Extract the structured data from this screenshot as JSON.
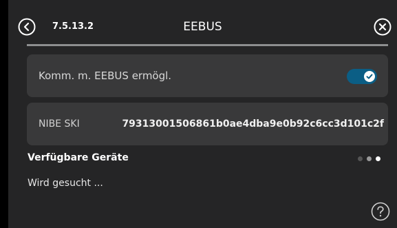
{
  "header": {
    "menu_number": "7.5.13.2",
    "title": "EEBUS"
  },
  "settings": {
    "enable_label": "Komm. m. EEBUS ermögl.",
    "enable_toggle_on": true,
    "ski_label": "NIBE SKI",
    "ski_value": "79313001506861b0ae4dba9e0b92c6cc3d101c2f"
  },
  "devices": {
    "title": "Verfügbare Geräte",
    "status": "Wird gesucht ..."
  },
  "pagination": {
    "pages": 3,
    "current": 3
  },
  "icons": {
    "back": "chevron-left-icon",
    "close": "close-icon",
    "check": "check-icon",
    "help": "question-mark-icon"
  },
  "colors": {
    "accent": "#0b5e85",
    "background": "#252526",
    "card": "#39393a"
  }
}
